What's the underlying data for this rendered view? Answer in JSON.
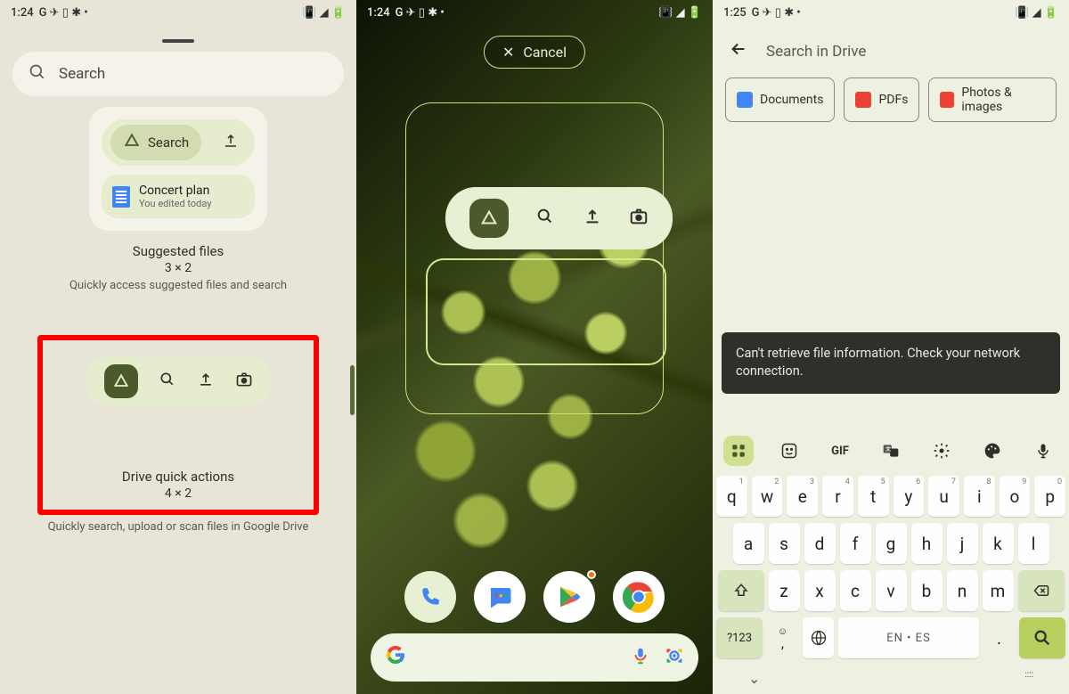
{
  "screen1": {
    "status": {
      "time": "1:24",
      "icons": "G ✈ ▯ ✱ •"
    },
    "search_placeholder": "Search",
    "widget_a": {
      "search_label": "Search",
      "file_title": "Concert plan",
      "file_sub": "You edited today",
      "name": "Suggested files",
      "size": "3 × 2",
      "desc": "Quickly access suggested files and search"
    },
    "widget_b": {
      "name": "Drive quick actions",
      "size": "4 × 2",
      "desc": "Quickly search, upload or scan files in Google Drive"
    }
  },
  "screen2": {
    "status": {
      "time": "1:24",
      "icons": "G ✈ ▯ ✱ •"
    },
    "cancel": "Cancel"
  },
  "screen3": {
    "status": {
      "time": "1:25",
      "icons": "G ✈ ▯ ✱ •"
    },
    "search_placeholder": "Search in Drive",
    "chips": {
      "docs": "Documents",
      "pdfs": "PDFs",
      "images": "Photos & images"
    },
    "toast": "Can't retrieve file information. Check your network connection.",
    "keyboard": {
      "row1": [
        "q",
        "w",
        "e",
        "r",
        "t",
        "y",
        "u",
        "i",
        "o",
        "p"
      ],
      "row1_sup": [
        "1",
        "2",
        "3",
        "4",
        "5",
        "6",
        "7",
        "8",
        "9",
        "0"
      ],
      "row2": [
        "a",
        "s",
        "d",
        "f",
        "g",
        "h",
        "j",
        "k",
        "l"
      ],
      "row3": [
        "z",
        "x",
        "c",
        "v",
        "b",
        "n",
        "m"
      ],
      "sym": "?123",
      "lang": "EN • ES",
      "gif": "GIF"
    }
  }
}
